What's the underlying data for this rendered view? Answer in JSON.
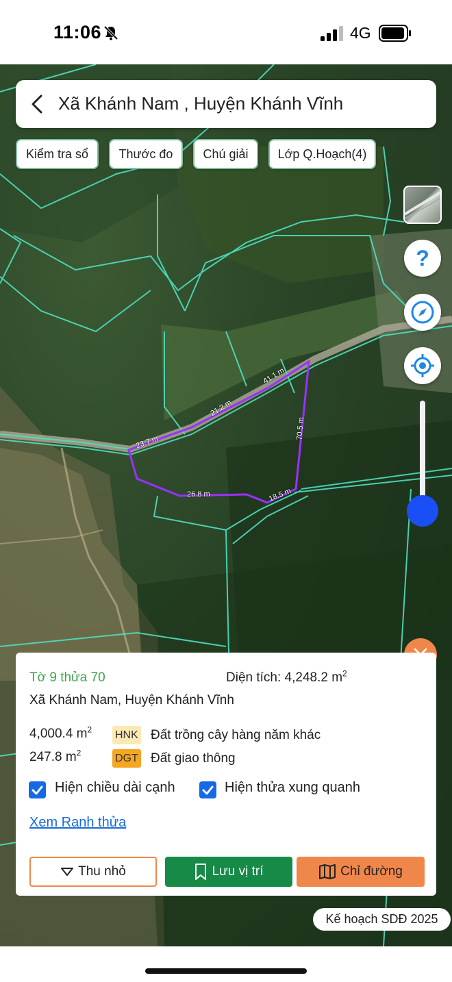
{
  "status_bar": {
    "time": "11:06",
    "network": "4G",
    "icons": [
      "bell-slash-icon",
      "signal-icon",
      "battery-icon"
    ]
  },
  "header": {
    "title": "Xã Khánh Nam , Huyện Khánh Vĩnh",
    "back_icon": "chevron-left-icon"
  },
  "chips": [
    {
      "label": "Kiểm tra sổ"
    },
    {
      "label": "Thước đo"
    },
    {
      "label": "Chú giải"
    },
    {
      "label": "Lớp Q.Hoạch(4)"
    }
  ],
  "map": {
    "edge_labels": [
      "41.1 m",
      "21.2 m",
      "23.7 m",
      "70.5 m",
      "26.8 m",
      "18.5 m"
    ],
    "parcel_outline_color": "#9b30ff",
    "boundary_color": "#4ee0c0",
    "controls": [
      "layer-thumbnail",
      "help-icon",
      "compass-icon",
      "locate-icon",
      "zoom-slider"
    ]
  },
  "parcel": {
    "id_label": "Tờ 9 thửa 70",
    "area_label": "Diện tích: 4,248.2 m",
    "area_unit_sup": "2",
    "address": "Xã Khánh Nam, Huyện Khánh Vĩnh",
    "land_uses": [
      {
        "area": "4,000.4 m",
        "sup": "2",
        "code": "HNK",
        "code_color": "#fbe9b5",
        "description": "Đất trồng cây hàng năm khác"
      },
      {
        "area": "247.8 m",
        "sup": "2",
        "code": "DGT",
        "code_color": "#f5a623",
        "description": "Đất giao thông"
      }
    ],
    "options": [
      {
        "label": "Hiện chiều dài cạnh",
        "checked": true
      },
      {
        "label": "Hiện thửa xung quanh",
        "checked": true
      }
    ],
    "link": "Xem Ranh thửa",
    "buttons": {
      "collapse": "Thu nhỏ",
      "save": "Lưu vị trí",
      "directions": "Chỉ đường"
    }
  },
  "plan_badge": "Kế hoạch SDĐ 2025",
  "colors": {
    "accent_orange": "#f0874a",
    "accent_green": "#178a47",
    "link_blue": "#1a6ad8",
    "checkbox_blue": "#1668e6",
    "zoom_blue": "#1a4ff5"
  }
}
